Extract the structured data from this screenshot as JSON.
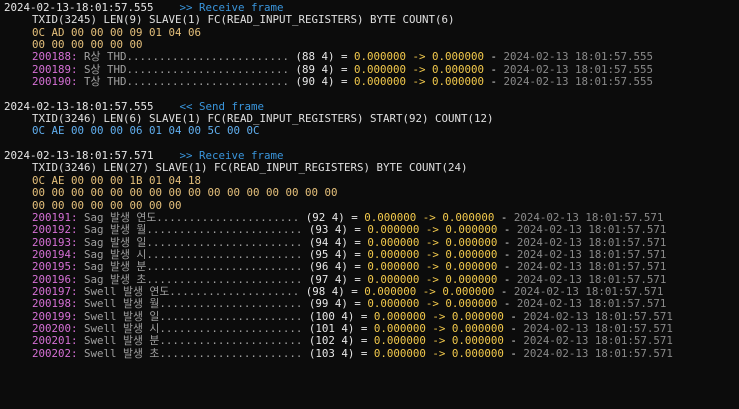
{
  "frames": [
    {
      "timestamp": "2024-02-13-18:01:57.555",
      "direction": ">> Receive frame",
      "header": "TXID(3245) LEN(9) SLAVE(1) FC(READ_INPUT_REGISTERS) BYTE COUNT(6)",
      "hex_lines": [
        "0C AD 00 00 00 09 01 04 06",
        "00 00 00 00 00 00"
      ],
      "kind": "recv",
      "points": [
        {
          "addr": "200188:",
          "label": " R상 THD.........................",
          "reg": " (88 4) = ",
          "old": "0.000000",
          "arrow": " -> ",
          "new": "0.000000",
          "dash": " - ",
          "time": "2024-02-13 18:01:57.555"
        },
        {
          "addr": "200189:",
          "label": " S상 THD.........................",
          "reg": " (89 4) = ",
          "old": "0.000000",
          "arrow": " -> ",
          "new": "0.000000",
          "dash": " - ",
          "time": "2024-02-13 18:01:57.555"
        },
        {
          "addr": "200190:",
          "label": " T상 THD.........................",
          "reg": " (90 4) = ",
          "old": "0.000000",
          "arrow": " -> ",
          "new": "0.000000",
          "dash": " - ",
          "time": "2024-02-13 18:01:57.555"
        }
      ]
    },
    {
      "timestamp": "2024-02-13-18:01:57.555",
      "direction": "<< Send frame",
      "header": "TXID(3246) LEN(6) SLAVE(1) FC(READ_INPUT_REGISTERS) START(92) COUNT(12)",
      "hex_lines": [
        "0C AE 00 00 00 06 01 04 00 5C 00 0C"
      ],
      "kind": "send",
      "points": []
    },
    {
      "timestamp": "2024-02-13-18:01:57.571",
      "direction": ">> Receive frame",
      "header": "TXID(3246) LEN(27) SLAVE(1) FC(READ_INPUT_REGISTERS) BYTE COUNT(24)",
      "hex_lines": [
        "0C AE 00 00 00 1B 01 04 18",
        "00 00 00 00 00 00 00 00 00 00 00 00 00 00 00 00",
        "00 00 00 00 00 00 00 00"
      ],
      "kind": "recv",
      "points": [
        {
          "addr": "200191:",
          "label": " Sag 발생 연도......................",
          "reg": " (92 4) = ",
          "old": "0.000000",
          "arrow": " -> ",
          "new": "0.000000",
          "dash": " - ",
          "time": "2024-02-13 18:01:57.571"
        },
        {
          "addr": "200192:",
          "label": " Sag 발생 월........................",
          "reg": " (93 4) = ",
          "old": "0.000000",
          "arrow": " -> ",
          "new": "0.000000",
          "dash": " - ",
          "time": "2024-02-13 18:01:57.571"
        },
        {
          "addr": "200193:",
          "label": " Sag 발생 일........................",
          "reg": " (94 4) = ",
          "old": "0.000000",
          "arrow": " -> ",
          "new": "0.000000",
          "dash": " - ",
          "time": "2024-02-13 18:01:57.571"
        },
        {
          "addr": "200194:",
          "label": " Sag 발생 시........................",
          "reg": " (95 4) = ",
          "old": "0.000000",
          "arrow": " -> ",
          "new": "0.000000",
          "dash": " - ",
          "time": "2024-02-13 18:01:57.571"
        },
        {
          "addr": "200195:",
          "label": " Sag 발생 분........................",
          "reg": " (96 4) = ",
          "old": "0.000000",
          "arrow": " -> ",
          "new": "0.000000",
          "dash": " - ",
          "time": "2024-02-13 18:01:57.571"
        },
        {
          "addr": "200196:",
          "label": " Sag 발생 초........................",
          "reg": " (97 4) = ",
          "old": "0.000000",
          "arrow": " -> ",
          "new": "0.000000",
          "dash": " - ",
          "time": "2024-02-13 18:01:57.571"
        },
        {
          "addr": "200197:",
          "label": " Swell 발생 연도....................",
          "reg": " (98 4) = ",
          "old": "0.000000",
          "arrow": " -> ",
          "new": "0.000000",
          "dash": " - ",
          "time": "2024-02-13 18:01:57.571"
        },
        {
          "addr": "200198:",
          "label": " Swell 발생 월......................",
          "reg": " (99 4) = ",
          "old": "0.000000",
          "arrow": " -> ",
          "new": "0.000000",
          "dash": " - ",
          "time": "2024-02-13 18:01:57.571"
        },
        {
          "addr": "200199:",
          "label": " Swell 발생 일......................",
          "reg": " (100 4) = ",
          "old": "0.000000",
          "arrow": " -> ",
          "new": "0.000000",
          "dash": " - ",
          "time": "2024-02-13 18:01:57.571"
        },
        {
          "addr": "200200:",
          "label": " Swell 발생 시......................",
          "reg": " (101 4) = ",
          "old": "0.000000",
          "arrow": " -> ",
          "new": "0.000000",
          "dash": " - ",
          "time": "2024-02-13 18:01:57.571"
        },
        {
          "addr": "200201:",
          "label": " Swell 발생 분......................",
          "reg": " (102 4) = ",
          "old": "0.000000",
          "arrow": " -> ",
          "new": "0.000000",
          "dash": " - ",
          "time": "2024-02-13 18:01:57.571"
        },
        {
          "addr": "200202:",
          "label": " Swell 발생 초......................",
          "reg": " (103 4) = ",
          "old": "0.000000",
          "arrow": " -> ",
          "new": "0.000000",
          "dash": " - ",
          "time": "2024-02-13 18:01:57.571"
        }
      ]
    }
  ],
  "colors": {
    "background": "#0c0c0c",
    "timestamp": "#e8e8e8",
    "direction": "#3a96dd",
    "recv_hex": "#e5c07b",
    "send_hex": "#61afef",
    "address": "#d670d6",
    "value": "#f2c94c",
    "point_time": "#8a8a8a"
  }
}
